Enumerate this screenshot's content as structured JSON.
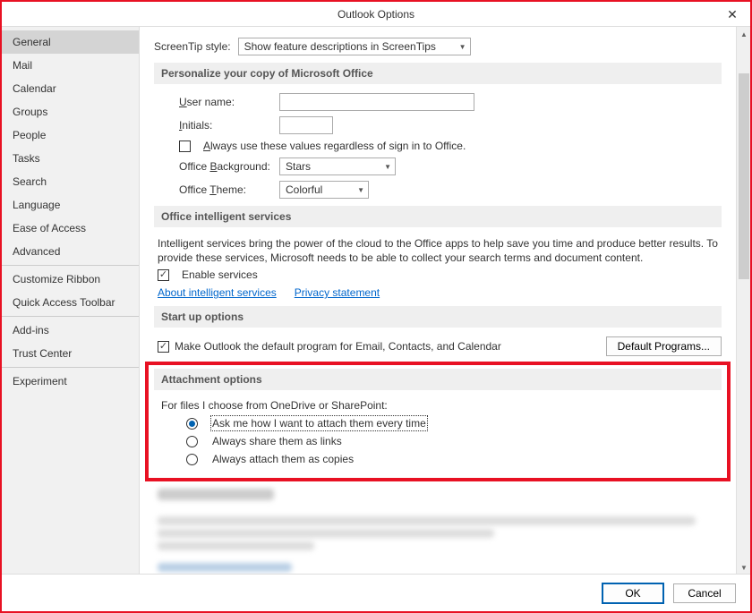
{
  "window": {
    "title": "Outlook Options"
  },
  "sidebar": {
    "items": [
      "General",
      "Mail",
      "Calendar",
      "Groups",
      "People",
      "Tasks",
      "Search",
      "Language",
      "Ease of Access",
      "Advanced",
      "Customize Ribbon",
      "Quick Access Toolbar",
      "Add-ins",
      "Trust Center",
      "Experiment"
    ],
    "selectedIndex": 0,
    "separatorAfter": [
      9,
      11,
      13
    ]
  },
  "screentip": {
    "label": "ScreenTip style:",
    "value": "Show feature descriptions in ScreenTips"
  },
  "personalize": {
    "header": "Personalize your copy of Microsoft Office",
    "username_label": "User name:",
    "username_value": "",
    "initials_label": "Initials:",
    "initials_value": "",
    "always_use_label": "Always use these values regardless of sign in to Office.",
    "always_use_checked": false,
    "background_label": "Office Background:",
    "background_value": "Stars",
    "theme_label": "Office Theme:",
    "theme_value": "Colorful"
  },
  "intelligent": {
    "header": "Office intelligent services",
    "desc": "Intelligent services bring the power of the cloud to the Office apps to help save you time and produce better results. To provide these services, Microsoft needs to be able to collect your search terms and document content.",
    "enable_label": "Enable services",
    "enable_checked": true,
    "link_about": "About intelligent services",
    "link_privacy": "Privacy statement"
  },
  "startup": {
    "header": "Start up options",
    "default_checkbox_label": "Make Outlook the default program for Email, Contacts, and Calendar",
    "default_checkbox_checked": true,
    "default_programs_btn": "Default Programs..."
  },
  "attachment": {
    "header": "Attachment options",
    "desc": "For files I choose from OneDrive or SharePoint:",
    "options": [
      "Ask me how I want to attach them every time",
      "Always share them as links",
      "Always attach them as copies"
    ],
    "selectedIndex": 0
  },
  "footer": {
    "ok": "OK",
    "cancel": "Cancel"
  }
}
